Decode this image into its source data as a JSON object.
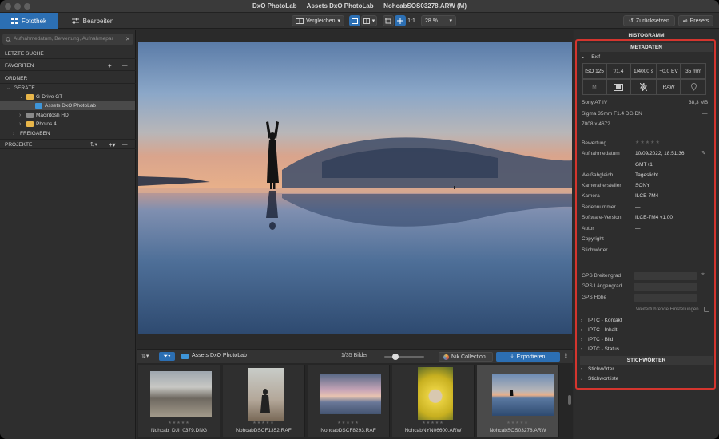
{
  "window": {
    "title": "DxO PhotoLab — Assets DxO PhotoLab — NohcabSOS03278.ARW (M)"
  },
  "toolbar": {
    "tab_library": "Fotothek",
    "tab_edit": "Bearbeiten",
    "compare_label": "Vergleichen",
    "ratio_label": "1:1",
    "zoom_value": "28 %",
    "reset_label": "Zurücksetzen",
    "presets_label": "Presets"
  },
  "left": {
    "search_placeholder": "Aufnahmedatum, Bewertung, Aufnahmepar",
    "recent_search": "LETZTE SUCHE",
    "favorites": "FAVORITEN",
    "folders": "ORDNER",
    "devices": "GERÄTE",
    "drive": "G-Drive GT",
    "assets_folder": "Assets DxO PhotoLab",
    "mac_hd": "Macintosh HD",
    "photos": "Photos 4",
    "shares": "FREIGABEN",
    "projects": "PROJEKTE"
  },
  "filmbar": {
    "folder_name": "Assets DxO PhotoLab",
    "count": "1/35 Bilder",
    "nik_label": "Nik Collection",
    "export_label": "Exportieren"
  },
  "thumbnails": [
    {
      "name": "Nohcab_DJI_0379.DNG"
    },
    {
      "name": "NohcabDSCF1352.RAF"
    },
    {
      "name": "NohcabDSCF8293.RAF"
    },
    {
      "name": "NohcabNYN06600.ARW"
    },
    {
      "name": "NohcabSOS03278.ARW",
      "selected": true
    }
  ],
  "right": {
    "histogram": "HISTOGRAMM",
    "metadata": "METADATEN",
    "exif": "Exif",
    "exif_row1": [
      "ISO 125",
      "f/1.4",
      "1/4000 s",
      "+0.0 EV",
      "35 mm"
    ],
    "exif_raw": "RAW",
    "camera_model": "Sony A7 IV",
    "file_size": "38,3 MB",
    "lens": "Sigma 35mm F1.4 DG DN",
    "lens_dash": "—",
    "dimensions": "7008 x 4672",
    "fields": [
      {
        "label": "Bewertung",
        "value": "★★★★★"
      },
      {
        "label": "Aufnahmedatum",
        "value": "10/09/2022, 18:51:36"
      },
      {
        "label": "",
        "value": "GMT+1"
      },
      {
        "label": "Weißabgleich",
        "value": "Tageslicht"
      },
      {
        "label": "Kamerahersteller",
        "value": "SONY"
      },
      {
        "label": "Kamera",
        "value": "ILCE-7M4"
      },
      {
        "label": "Seriennummer",
        "value": "—"
      },
      {
        "label": "Software-Version",
        "value": "ILCE-7M4 v1.00"
      },
      {
        "label": "Autor",
        "value": "—"
      },
      {
        "label": "Copyright",
        "value": "—"
      },
      {
        "label": "Stichwörter",
        "value": ""
      }
    ],
    "gps_lat": "GPS Breitengrad",
    "gps_lon": "GPS Längengrad",
    "gps_alt": "GPS Höhe",
    "advanced": "Weiterführende Einstellungen",
    "iptc": [
      "IPTC - Kontakt",
      "IPTC - Inhalt",
      "IPTC - Bild",
      "IPTC - Status"
    ],
    "keywords_header": "STICHWÖRTER",
    "keywords": [
      "Stichwörter",
      "Stichwortliste"
    ]
  }
}
